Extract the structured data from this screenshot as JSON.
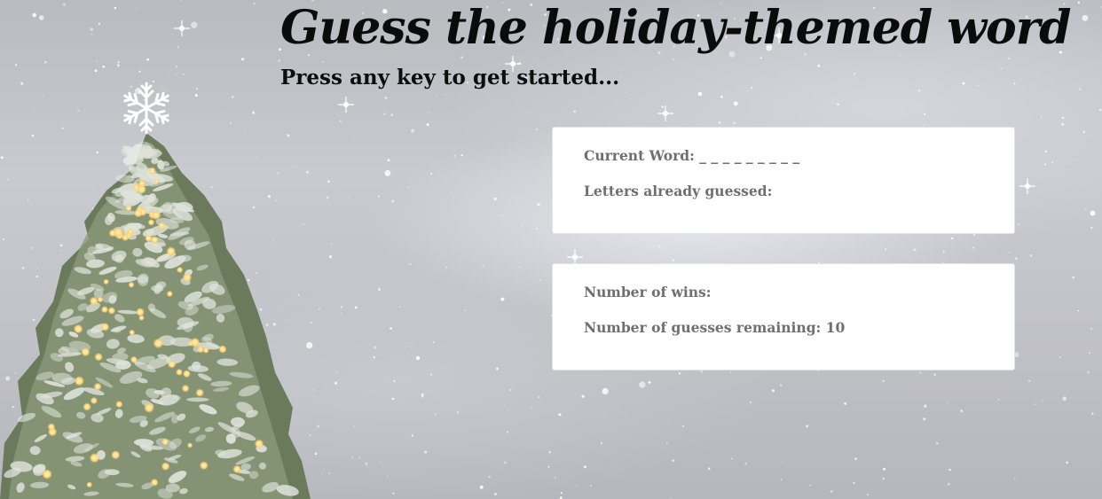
{
  "header": {
    "title": "Guess the holiday-themed word",
    "subtitle": "Press any key to get started..."
  },
  "word_card": {
    "current_word_label": "Current Word:",
    "current_word_value": "_ _ _ _ _ _ _ _ _",
    "letters_guessed_label": "Letters already guessed:",
    "letters_guessed_value": ""
  },
  "stats_card": {
    "wins_label": "Number of wins:",
    "wins_value": "",
    "guesses_remaining_label": "Number of guesses remaining:",
    "guesses_remaining_value": "10"
  },
  "background": {
    "image": "snowy-christmas-tree-scene",
    "icons": [
      "snowflake-icon",
      "christmas-tree"
    ]
  }
}
